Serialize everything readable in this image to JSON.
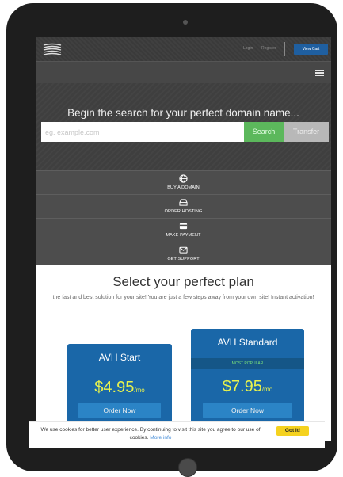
{
  "topbar": {
    "logo_icon": "stacked-waves-logo",
    "login_label": "Login",
    "register_label": "Register",
    "cart_label": "View Cart",
    "menu_icon": "hamburger-icon"
  },
  "hero": {
    "title": "Begin the search for your perfect domain name...",
    "search_placeholder": "eg. example.com",
    "search_label": "Search",
    "transfer_label": "Transfer"
  },
  "actions": [
    {
      "label": "BUY A DOMAIN",
      "icon": "globe-icon"
    },
    {
      "label": "ORDER HOSTING",
      "icon": "server-icon"
    },
    {
      "label": "MAKE PAYMENT",
      "icon": "credit-card-icon"
    },
    {
      "label": "GET SUPPORT",
      "icon": "envelope-icon"
    }
  ],
  "plans": {
    "title": "Select your perfect plan",
    "subtitle": "the fast and best solution for your site! You are just a few steps away from your own site! Instant activation!",
    "items": [
      {
        "name": "AVH Start",
        "price": "$4.95",
        "period": "/mo",
        "button": "Order Now"
      },
      {
        "name": "AVH Standard",
        "badge": "MOST POPULAR",
        "price": "$7.95",
        "period": "/mo",
        "button": "Order Now"
      }
    ]
  },
  "cookie": {
    "text": "We use cookies for better user experience. By continuing to visit this site you agree to our use of cookies.",
    "link": "More info",
    "button": "Got It!"
  },
  "colors": {
    "accent_blue": "#1a67a8",
    "search_green": "#5cb85c",
    "price_yellow": "#e8f24d",
    "cookie_yellow": "#f5d21f"
  }
}
